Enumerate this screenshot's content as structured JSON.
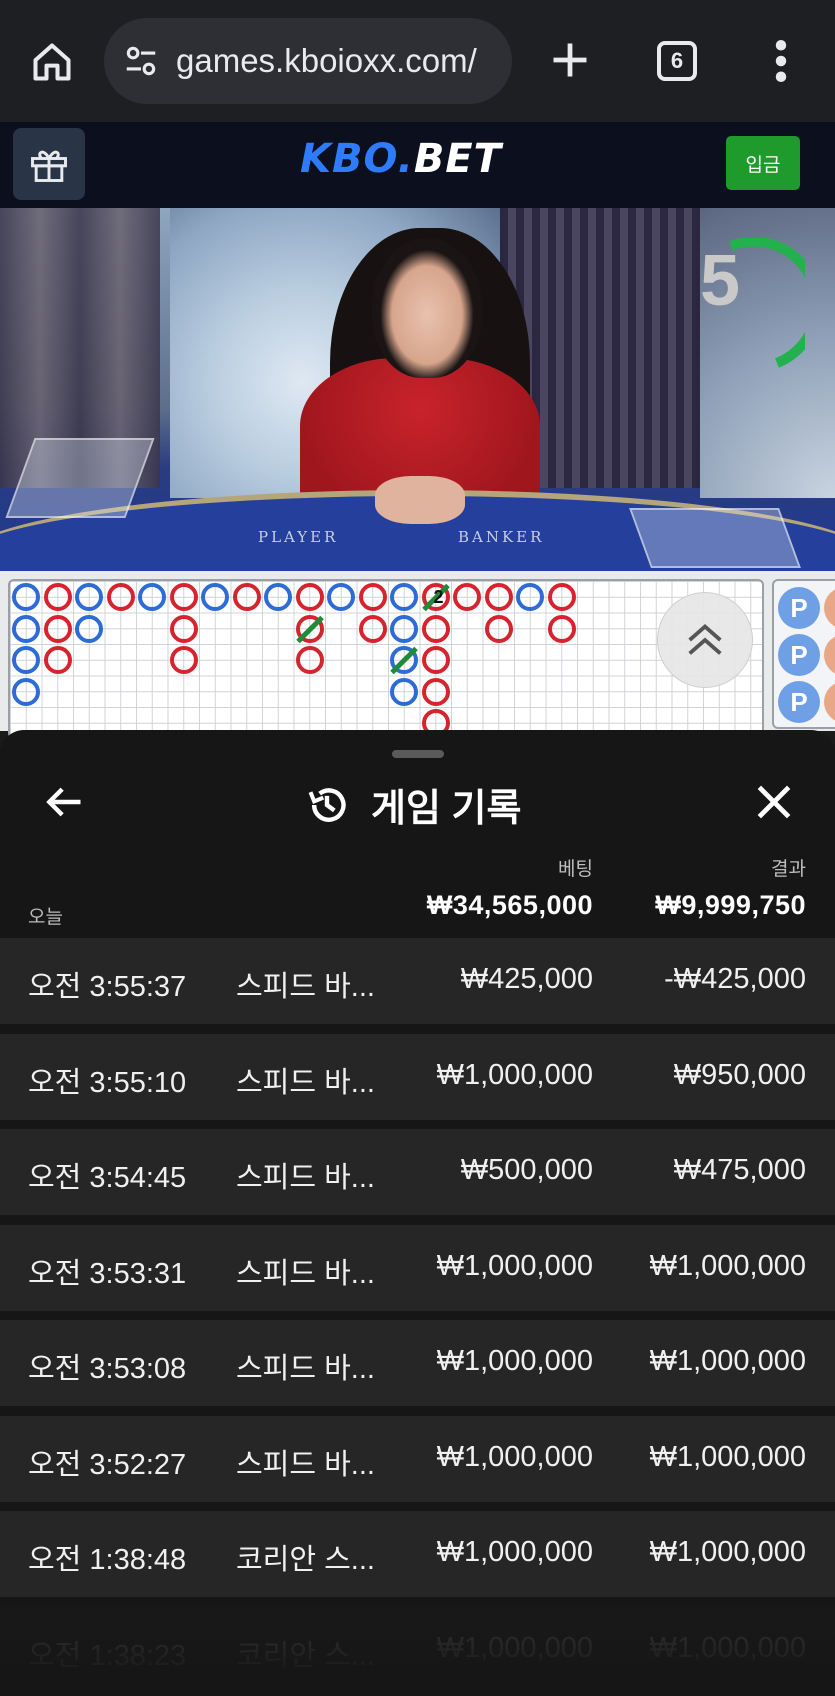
{
  "browser": {
    "url": "games.kboioxx.com/",
    "tab_count": "6",
    "icons": [
      "home-icon",
      "tune-icon",
      "plus-icon",
      "tabs-icon",
      "more-vert-icon"
    ]
  },
  "site": {
    "logo_kbo": "KBO",
    "logo_dot": ".",
    "logo_bet": "BET",
    "deposit_label": "입금",
    "gift_icon": "gift-icon"
  },
  "video": {
    "countdown": "5",
    "table_player": "PLAYER",
    "table_banker": "BANKER"
  },
  "roadmap": {
    "tie_number": "2",
    "side_chip_label": "P",
    "scroll_icon": "double-chevron-up-icon"
  },
  "sheet": {
    "title": "게임 기록",
    "back_icon": "arrow-left-icon",
    "history_icon": "history-icon",
    "close_icon": "close-icon",
    "header_bet": "베팅",
    "header_result": "결과",
    "today_label": "오늘",
    "total_bet": "₩34,565,000",
    "total_result": "₩9,999,750",
    "rows": [
      {
        "time": "오전 3:55:37",
        "game": "스피드 바...",
        "bet": "₩425,000",
        "result": "-₩425,000"
      },
      {
        "time": "오전 3:55:10",
        "game": "스피드 바...",
        "bet": "₩1,000,000",
        "result": "₩950,000"
      },
      {
        "time": "오전 3:54:45",
        "game": "스피드 바...",
        "bet": "₩500,000",
        "result": "₩475,000"
      },
      {
        "time": "오전 3:53:31",
        "game": "스피드 바...",
        "bet": "₩1,000,000",
        "result": "₩1,000,000"
      },
      {
        "time": "오전 3:53:08",
        "game": "스피드 바...",
        "bet": "₩1,000,000",
        "result": "₩1,000,000"
      },
      {
        "time": "오전 3:52:27",
        "game": "스피드 바...",
        "bet": "₩1,000,000",
        "result": "₩1,000,000"
      },
      {
        "time": "오전 1:38:48",
        "game": "코리안 스...",
        "bet": "₩1,000,000",
        "result": "₩1,000,000"
      },
      {
        "time": "오전 1:38:23",
        "game": "코리안 스...",
        "bet": "₩1,000,000",
        "result": "₩1,000,000"
      }
    ]
  },
  "colors": {
    "player_blue": "#2d6bd6",
    "banker_red": "#d6242e",
    "tie_green": "#1f8a3a",
    "deposit_green": "#1e9b2c",
    "logo_blue": "#2f7bff"
  }
}
